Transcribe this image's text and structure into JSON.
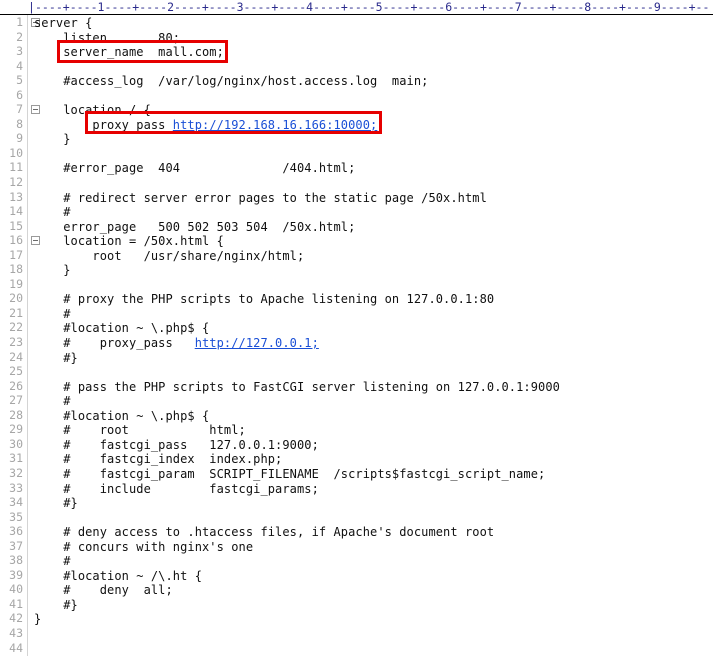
{
  "ruler": {
    "text": "|----+----1----+----2----+----3----+----4----+----5----+----6----+----7----+----8----+----9----+--"
  },
  "gutter": {
    "line_numbers": [
      "1",
      "2",
      "3",
      "4",
      "5",
      "6",
      "7",
      "8",
      "9",
      "10",
      "11",
      "12",
      "13",
      "14",
      "15",
      "16",
      "17",
      "18",
      "19",
      "20",
      "21",
      "22",
      "23",
      "24",
      "25",
      "26",
      "27",
      "28",
      "29",
      "30",
      "31",
      "32",
      "33",
      "34",
      "35",
      "36",
      "37",
      "38",
      "39",
      "40",
      "41",
      "42",
      "43",
      "44"
    ],
    "fold_marker_lines": [
      1,
      7,
      16
    ],
    "fold_icon": "fold-minus-icon"
  },
  "colors": {
    "background": "#ffffff",
    "text": "#101010",
    "line_number": "#a6a6a6",
    "ruler": "#2a2a8c",
    "link": "#1a4fd6",
    "highlight_box": "#e60000"
  },
  "highlights": [
    {
      "name": "server-name-highlight",
      "line": 3,
      "label": "server_name  mall.com;"
    },
    {
      "name": "proxy-pass-highlight",
      "line": 8,
      "label": "proxy_pass http://192.168.16.166:10000;"
    }
  ],
  "code": {
    "lines": [
      {
        "n": 1,
        "parts": [
          {
            "t": "server {"
          }
        ]
      },
      {
        "n": 2,
        "parts": [
          {
            "t": "    listen       80;"
          }
        ]
      },
      {
        "n": 3,
        "parts": [
          {
            "t": "    server_name  mall.com;"
          }
        ]
      },
      {
        "n": 4,
        "parts": [
          {
            "t": ""
          }
        ]
      },
      {
        "n": 5,
        "parts": [
          {
            "t": "    #access_log  /var/log/nginx/host.access.log  main;"
          }
        ]
      },
      {
        "n": 6,
        "parts": [
          {
            "t": ""
          }
        ]
      },
      {
        "n": 7,
        "parts": [
          {
            "t": "    location / {"
          }
        ]
      },
      {
        "n": 8,
        "parts": [
          {
            "t": "        proxy_pass "
          },
          {
            "t": "http://192.168.16.166:10000;",
            "link": true
          }
        ]
      },
      {
        "n": 9,
        "parts": [
          {
            "t": "    }"
          }
        ]
      },
      {
        "n": 10,
        "parts": [
          {
            "t": ""
          }
        ]
      },
      {
        "n": 11,
        "parts": [
          {
            "t": "    #error_page  404              /404.html;"
          }
        ]
      },
      {
        "n": 12,
        "parts": [
          {
            "t": ""
          }
        ]
      },
      {
        "n": 13,
        "parts": [
          {
            "t": "    # redirect server error pages to the static page /50x.html"
          }
        ]
      },
      {
        "n": 14,
        "parts": [
          {
            "t": "    #"
          }
        ]
      },
      {
        "n": 15,
        "parts": [
          {
            "t": "    error_page   500 502 503 504  /50x.html;"
          }
        ]
      },
      {
        "n": 16,
        "parts": [
          {
            "t": "    location = /50x.html {"
          }
        ]
      },
      {
        "n": 17,
        "parts": [
          {
            "t": "        root   /usr/share/nginx/html;"
          }
        ]
      },
      {
        "n": 18,
        "parts": [
          {
            "t": "    }"
          }
        ]
      },
      {
        "n": 19,
        "parts": [
          {
            "t": ""
          }
        ]
      },
      {
        "n": 20,
        "parts": [
          {
            "t": "    # proxy the PHP scripts to Apache listening on 127.0.0.1:80"
          }
        ]
      },
      {
        "n": 21,
        "parts": [
          {
            "t": "    #"
          }
        ]
      },
      {
        "n": 22,
        "parts": [
          {
            "t": "    #location ~ \\.php$ {"
          }
        ]
      },
      {
        "n": 23,
        "parts": [
          {
            "t": "    #    proxy_pass   "
          },
          {
            "t": "http://127.0.0.1;",
            "link": true
          }
        ]
      },
      {
        "n": 24,
        "parts": [
          {
            "t": "    #}"
          }
        ]
      },
      {
        "n": 25,
        "parts": [
          {
            "t": ""
          }
        ]
      },
      {
        "n": 26,
        "parts": [
          {
            "t": "    # pass the PHP scripts to FastCGI server listening on 127.0.0.1:9000"
          }
        ]
      },
      {
        "n": 27,
        "parts": [
          {
            "t": "    #"
          }
        ]
      },
      {
        "n": 28,
        "parts": [
          {
            "t": "    #location ~ \\.php$ {"
          }
        ]
      },
      {
        "n": 29,
        "parts": [
          {
            "t": "    #    root           html;"
          }
        ]
      },
      {
        "n": 30,
        "parts": [
          {
            "t": "    #    fastcgi_pass   127.0.0.1:9000;"
          }
        ]
      },
      {
        "n": 31,
        "parts": [
          {
            "t": "    #    fastcgi_index  index.php;"
          }
        ]
      },
      {
        "n": 32,
        "parts": [
          {
            "t": "    #    fastcgi_param  SCRIPT_FILENAME  /scripts$fastcgi_script_name;"
          }
        ]
      },
      {
        "n": 33,
        "parts": [
          {
            "t": "    #    include        fastcgi_params;"
          }
        ]
      },
      {
        "n": 34,
        "parts": [
          {
            "t": "    #}"
          }
        ]
      },
      {
        "n": 35,
        "parts": [
          {
            "t": ""
          }
        ]
      },
      {
        "n": 36,
        "parts": [
          {
            "t": "    # deny access to .htaccess files, if Apache's document root"
          }
        ]
      },
      {
        "n": 37,
        "parts": [
          {
            "t": "    # concurs with nginx's one"
          }
        ]
      },
      {
        "n": 38,
        "parts": [
          {
            "t": "    #"
          }
        ]
      },
      {
        "n": 39,
        "parts": [
          {
            "t": "    #location ~ /\\.ht {"
          }
        ]
      },
      {
        "n": 40,
        "parts": [
          {
            "t": "    #    deny  all;"
          }
        ]
      },
      {
        "n": 41,
        "parts": [
          {
            "t": "    #}"
          }
        ]
      },
      {
        "n": 42,
        "parts": [
          {
            "t": "}"
          }
        ]
      },
      {
        "n": 43,
        "parts": [
          {
            "t": ""
          }
        ]
      },
      {
        "n": 44,
        "parts": [
          {
            "t": ""
          }
        ]
      }
    ]
  }
}
